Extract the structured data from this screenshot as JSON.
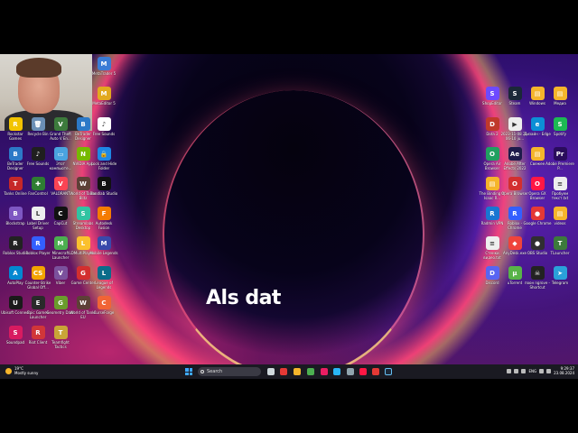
{
  "center_text": "Als dat",
  "webcam": {
    "label": "webcam-overlay"
  },
  "desktop": {
    "left_icons": [
      {
        "label": "MetaTrader 5",
        "color": "#3a7bd5",
        "glyph": "M"
      },
      {
        "label": "MetaEditor 5",
        "color": "#e2a91e",
        "glyph": "M"
      },
      {
        "label": "BeTrader Designer",
        "color": "#2c79c7",
        "glyph": "B"
      },
      {
        "label": "Free Sounds",
        "color": "#ffffff",
        "glyph": "♪"
      },
      {
        "label": "Rockstar Games",
        "color": "#f2c400",
        "glyph": "R"
      },
      {
        "label": "Recycle Bin",
        "color": "#6b8fb5",
        "glyph": "🗑"
      },
      {
        "label": "Grand Theft Auto V En...",
        "color": "#3c7a3c",
        "glyph": "V"
      },
      {
        "label": "BeTrader Designer",
        "color": "#2c79c7",
        "glyph": "B"
      },
      {
        "label": "Free Sounds",
        "color": "#1f1f1f",
        "glyph": "♪"
      },
      {
        "label": "Этот компьюте...",
        "color": "#4aa3df",
        "glyph": "▭"
      },
      {
        "label": "NVIDIA App",
        "color": "#76b900",
        "glyph": "N"
      },
      {
        "label": "Lock and Hide Folder",
        "color": "#1e88e5",
        "glyph": "🔒"
      },
      {
        "label": "Tanks Online",
        "color": "#c62828",
        "glyph": "T"
      },
      {
        "label": "FanControl",
        "color": "#2e7d32",
        "glyph": "✚"
      },
      {
        "label": "VALORANT",
        "color": "#fa4454",
        "glyph": "V"
      },
      {
        "label": "World of Tanks Blitz",
        "color": "#5d4037",
        "glyph": "W"
      },
      {
        "label": "Bandlab Studio",
        "color": "#111111",
        "glyph": "B"
      },
      {
        "label": "Blockstrap",
        "color": "#7e57c2",
        "glyph": "B"
      },
      {
        "label": "Label Driver Setup",
        "color": "#eeeeee",
        "glyph": "L"
      },
      {
        "label": "CapCut",
        "color": "#111111",
        "glyph": "C"
      },
      {
        "label": "Streamlabs Desktop",
        "color": "#31c3a2",
        "glyph": "S"
      },
      {
        "label": "Autodesk Fusion",
        "color": "#f57c00",
        "glyph": "F"
      },
      {
        "label": "Roblox Studio",
        "color": "#222222",
        "glyph": "R"
      },
      {
        "label": "Roblox Player",
        "color": "#335fff",
        "glyph": "R"
      },
      {
        "label": "Minecraft Launcher",
        "color": "#4caf50",
        "glyph": "M"
      },
      {
        "label": "LDMultiPlayer...",
        "color": "#fbc02d",
        "glyph": "L"
      },
      {
        "label": "Mobile Legends",
        "color": "#3949ab",
        "glyph": "M"
      },
      {
        "label": "AutoPlay",
        "color": "#0288d1",
        "glyph": "A"
      },
      {
        "label": "Counter-Strike Global Off...",
        "color": "#f4a300",
        "glyph": "CS"
      },
      {
        "label": "Viber",
        "color": "#7b519d",
        "glyph": "V"
      },
      {
        "label": "Game Center",
        "color": "#d32f2f",
        "glyph": "G"
      },
      {
        "label": "League of Legends",
        "color": "#0a6c8a",
        "glyph": "L"
      },
      {
        "label": "Ubisoft Connect",
        "color": "#1a1a1a",
        "glyph": "U"
      },
      {
        "label": "Epic Games Launcher",
        "color": "#2a2a2a",
        "glyph": "E"
      },
      {
        "label": "Geometry Dash",
        "color": "#6a9c2c",
        "glyph": "G"
      },
      {
        "label": "World of Tanks EU",
        "color": "#5d4037",
        "glyph": "W"
      },
      {
        "label": "CurseForge",
        "color": "#f16436",
        "glyph": "C"
      },
      {
        "label": "Soundpad",
        "color": "#d81b60",
        "glyph": "S"
      },
      {
        "label": "Riot Client",
        "color": "#d13639",
        "glyph": "R"
      },
      {
        "label": "Teamfight Tactics",
        "color": "#c9a437",
        "glyph": "T"
      }
    ],
    "right_icons": [
      {
        "label": "ShopEditor",
        "color": "#6d4aff",
        "glyph": "S"
      },
      {
        "label": "Steam",
        "color": "#1b2838",
        "glyph": "S"
      },
      {
        "label": "Windows",
        "color": "#f5b52b",
        "glyph": "▤"
      },
      {
        "label": "Медиа",
        "color": "#f5b52b",
        "glyph": "▤"
      },
      {
        "label": "Dota 2",
        "color": "#c0392b",
        "glyph": "D"
      },
      {
        "label": "2023-11-08 21-06-10 ju...",
        "color": "#eeeeee",
        "glyph": "▶"
      },
      {
        "label": "Дизайн - Edge",
        "color": "#0c8fd6",
        "glyph": "e"
      },
      {
        "label": "Spotify",
        "color": "#1db954",
        "glyph": "S"
      },
      {
        "label": "Opera Air Browser",
        "color": "#20a060",
        "glyph": "O"
      },
      {
        "label": "Adobe After Effects 2022",
        "color": "#1e1b4b",
        "glyph": "Ae"
      },
      {
        "label": "Свежее",
        "color": "#f5b52b",
        "glyph": "▤"
      },
      {
        "label": "Adobe Premiere P...",
        "color": "#2a0c5c",
        "glyph": "Pr"
      },
      {
        "label": "The Binding of Isaac R...",
        "color": "#f5b52b",
        "glyph": "▤"
      },
      {
        "label": "Opera Browser",
        "color": "#d32f2f",
        "glyph": "O"
      },
      {
        "label": "Opera GX Browser",
        "color": "#ff1744",
        "glyph": "O"
      },
      {
        "label": "Пробуем текст.txt",
        "color": "#eeeeee",
        "glyph": "≡"
      },
      {
        "label": "Radmin VPN",
        "color": "#1976d2",
        "glyph": "R"
      },
      {
        "label": "Roblox - Chrome",
        "color": "#335fff",
        "glyph": "R"
      },
      {
        "label": "Google Chrome",
        "color": "#e53935",
        "glyph": "●"
      },
      {
        "label": "videos",
        "color": "#f5b52b",
        "glyph": "▤"
      },
      {
        "label": "Стенки видео.txt",
        "color": "#eeeeee",
        "glyph": "≡"
      },
      {
        "label": "AnyDesk.exe",
        "color": "#ef443b",
        "glyph": "◆"
      },
      {
        "label": "OBS Studio",
        "color": "#302e31",
        "glyph": "●"
      },
      {
        "label": "TLauncher",
        "color": "#3c7a3c",
        "glyph": "T"
      },
      {
        "label": "Discord",
        "color": "#5865f2",
        "glyph": "D"
      },
      {
        "label": "uTorrent",
        "color": "#58b348",
        "glyph": "μ"
      },
      {
        "label": "поон ngrove - Shortcut",
        "color": "#222222",
        "glyph": "☠"
      },
      {
        "label": "Telegram",
        "color": "#2aa1da",
        "glyph": "➤"
      }
    ]
  },
  "taskbar": {
    "weather_temp": "19°C",
    "weather_desc": "Mostly sunny",
    "search_placeholder": "Search",
    "tray_lang": "ENG",
    "clock_time": "9:29:37",
    "clock_date": "23.08.2024"
  }
}
